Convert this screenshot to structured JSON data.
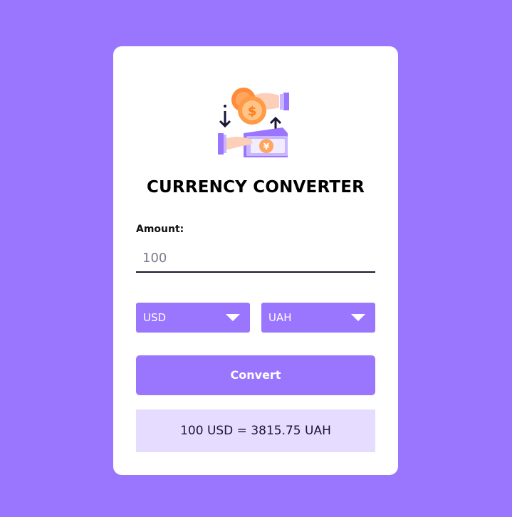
{
  "app": {
    "title": "CURRENCY CONVERTER"
  },
  "form": {
    "amount_label": "Amount:",
    "amount_value": "100",
    "from_currency": "USD",
    "to_currency": "UAH",
    "convert_label": "Convert"
  },
  "result": {
    "text": "100 USD = 3815.75 UAH"
  },
  "icons": {
    "illustration": "currency-exchange-icon",
    "dropdown_caret": "chevron-down-icon"
  },
  "colors": {
    "background": "#9a76ff",
    "accent": "#9a76ff",
    "result_bg": "#e6dcff"
  }
}
